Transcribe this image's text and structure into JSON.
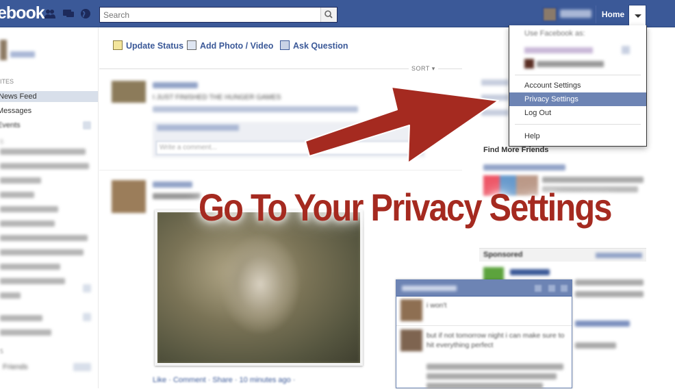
{
  "topbar": {
    "logo": "ebook",
    "search_placeholder": "Search",
    "home_label": "Home",
    "account_menu_icon": "chevron-down-icon"
  },
  "leftcol": {
    "items": [
      "News Feed",
      "Messages",
      "Events"
    ],
    "sections": [
      "ITES",
      "5",
      "Friends"
    ]
  },
  "composer": {
    "update_status": "Update Status",
    "add_photo": "Add Photo / Video",
    "ask_question": "Ask Question"
  },
  "feed": {
    "sort_label": "SORT",
    "story1_text": "I JUST FINISHED THE HUNGER GAMES",
    "comment_placeholder": "Write a comment...",
    "story2_actions": "Like · Comment · Share · 10 minutes ago ·"
  },
  "rightcol": {
    "find_friends_header": "Find More Friends",
    "sponsored_header": "Sponsored"
  },
  "chat": {
    "msg1": "i won't",
    "msg2": "but if not tomorrow night i can make sure to hit everything perfect"
  },
  "account_menu": {
    "use_as_label": "Use Facebook as:",
    "items": [
      "Account Settings",
      "Privacy Settings",
      "Log Out",
      "Help"
    ],
    "highlighted": "Privacy Settings"
  },
  "overlay": {
    "headline": "Go To Your Privacy Settings",
    "arrow_color": "#a52a20"
  },
  "colors": {
    "brand_blue": "#3b5998",
    "highlight": "#6d84b4"
  }
}
